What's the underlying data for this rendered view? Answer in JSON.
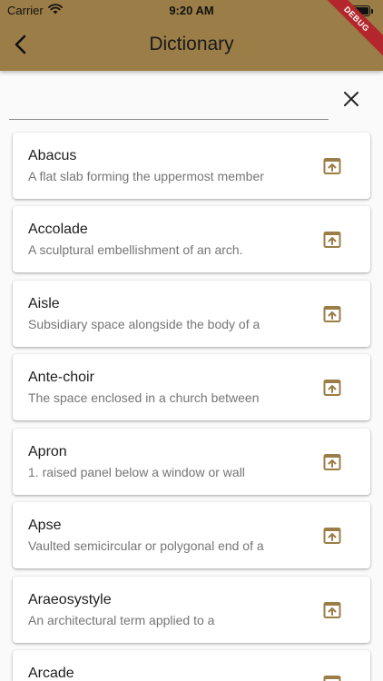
{
  "status_bar": {
    "carrier": "Carrier",
    "time": "9:20 AM"
  },
  "appbar": {
    "title": "Dictionary",
    "debug_label": "DEBUG",
    "back_icon": "chevron-left-icon"
  },
  "search": {
    "value": "",
    "placeholder": "",
    "clear_icon": "close-icon"
  },
  "colors": {
    "appbar": "#9b7d47",
    "icon_accent": "#9b7d47",
    "debug": "#b3262b"
  },
  "entries": [
    {
      "term": "Abacus",
      "description": "A flat slab forming the uppermost member"
    },
    {
      "term": "Accolade",
      "description": "A sculptural embellishment of an arch."
    },
    {
      "term": "Aisle",
      "description": "Subsidiary space alongside the body of a"
    },
    {
      "term": "Ante-choir",
      "description": "The space enclosed in a church between"
    },
    {
      "term": "Apron",
      "description": "1. raised panel below a window or wall"
    },
    {
      "term": "Apse",
      "description": "Vaulted semicircular or polygonal end of a"
    },
    {
      "term": "Araeosystyle",
      "description": "An architectural term applied to a"
    },
    {
      "term": "Arcade",
      "description": ""
    }
  ]
}
